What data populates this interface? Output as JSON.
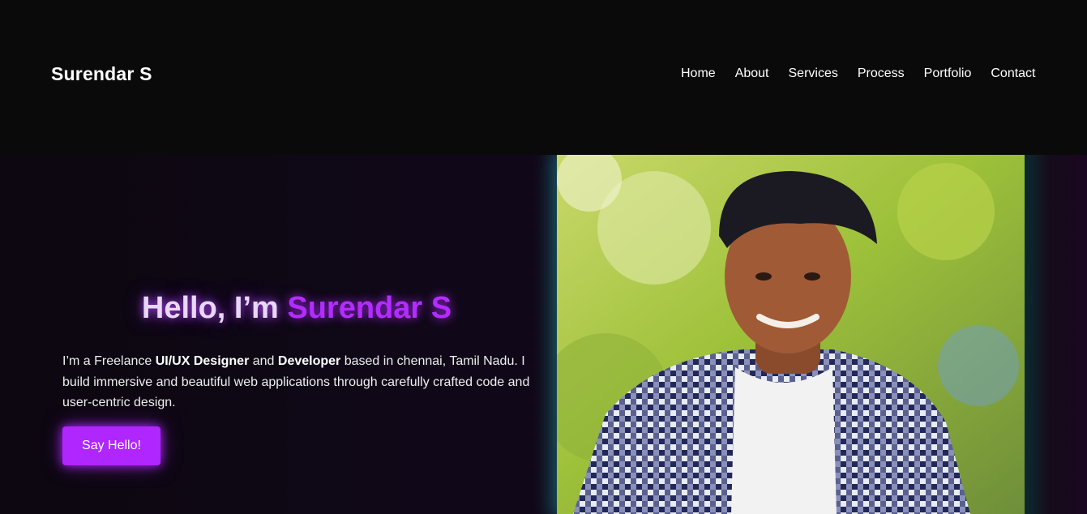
{
  "header": {
    "brand": "Surendar S",
    "nav": [
      "Home",
      "About",
      "Services",
      "Process",
      "Portfolio",
      "Contact"
    ]
  },
  "hero": {
    "greeting": "Hello, I’m ",
    "name": "Surendar S",
    "bio": {
      "p1": "I’m a Freelance ",
      "b1": "UI/UX Designer",
      "p2": " and ",
      "b2": "Developer",
      "p3": " based in chennai, Tamil Nadu. I build immersive and beautiful web applications through carefully crafted code and user-centric design."
    },
    "cta_label": "Say Hello!",
    "photo_icon": "portrait-photo"
  },
  "colors": {
    "accent": "#b026ff",
    "background": "#0a0a0a",
    "photo_glow": "#28c8d2"
  }
}
